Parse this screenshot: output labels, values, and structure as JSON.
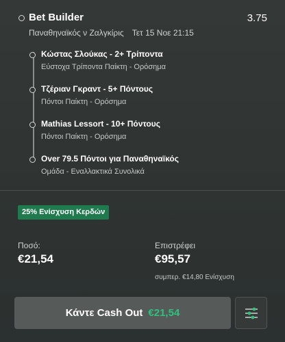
{
  "bet": {
    "title": "Bet Builder",
    "odds": "3.75",
    "match": "Παναθηναϊκός ν Ζαλγκίρις",
    "datetime": "Τετ 15 Νοε 21:15"
  },
  "selections": [
    {
      "title": "Κώστας Σλούκας - 2+ Τρίποντα",
      "subtitle": "Εύστοχα Τρίποντα Παίκτη - Ορόσημα"
    },
    {
      "title": "Τζέριαν Γκραντ - 5+ Πόντους",
      "subtitle": "Πόντοι Παίκτη - Ορόσημα"
    },
    {
      "title": "Mathias Lessort - 10+ Πόντους",
      "subtitle": "Πόντοι Παίκτη - Ορόσημα"
    },
    {
      "title": "Over 79.5 Πόντοι για Παναθηναϊκός",
      "subtitle": "Ομάδα - Εναλλακτικά Συνολικά"
    }
  ],
  "boost": {
    "label": "25% Ενίσχυση Κερδών"
  },
  "stake": {
    "label": "Ποσό:",
    "value": "€21,54"
  },
  "returns": {
    "label": "Επιστρέφει",
    "value": "€95,57",
    "note": "συμπερ. €14,80 Ενίσχυση"
  },
  "cashout": {
    "label": "Κάντε Cash Out",
    "amount": "€21,54"
  },
  "colors": {
    "accent_green": "#2ec27e",
    "badge_green": "#1f7a4e",
    "button_bg": "#565a58"
  },
  "icons": {
    "settings": "sliders-icon"
  }
}
